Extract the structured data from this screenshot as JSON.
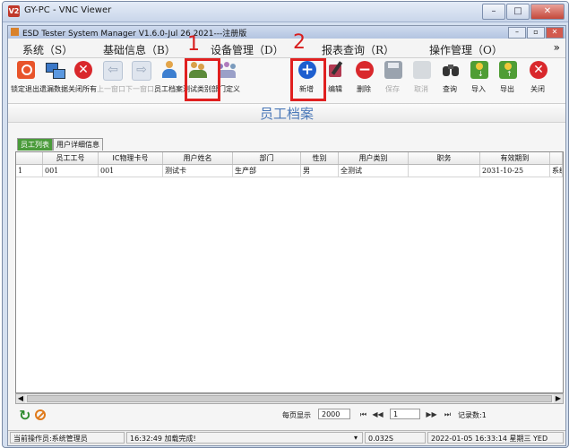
{
  "vnc": {
    "title": "GY-PC - VNC Viewer"
  },
  "app": {
    "title": "ESD Tester System Manager V1.6.0-Jul 26 2021---注册版"
  },
  "menu": [
    {
      "label": "系统（S）"
    },
    {
      "label": "基础信息（B）"
    },
    {
      "label": "设备管理（D）"
    },
    {
      "label": "报表查询（R）"
    },
    {
      "label": "操作管理（O）"
    }
  ],
  "menu_more": "»",
  "toolbar": [
    {
      "label": "锁定退出",
      "icon": "power-icon",
      "color": "#e8542a",
      "enabled": true
    },
    {
      "label": "遗漏数据",
      "icon": "network-icon",
      "color": "#3b78c8",
      "enabled": true
    },
    {
      "label": "关闭所有",
      "icon": "close-circle-icon",
      "color": "#d9282c",
      "enabled": true
    },
    {
      "label": "上一窗口",
      "icon": "arrow-left-icon",
      "color": "#b8c4d4",
      "enabled": false
    },
    {
      "label": "下一窗口",
      "icon": "arrow-right-icon",
      "color": "#b8c4d4",
      "enabled": false
    },
    {
      "label": "员工档案",
      "icon": "user-icon",
      "color": "#e3a54a",
      "enabled": true
    },
    {
      "label": "测试类别",
      "icon": "users-icon",
      "color": "#d9a049",
      "enabled": true
    },
    {
      "label": "部门定义",
      "icon": "group-icon",
      "color": "#8a7bbd",
      "enabled": true
    },
    {
      "label": "新增",
      "icon": "plus-circle-icon",
      "color": "#1e5fcf",
      "enabled": true
    },
    {
      "label": "编辑",
      "icon": "edit-icon",
      "color": "#b23a52",
      "enabled": true
    },
    {
      "label": "删除",
      "icon": "minus-circle-icon",
      "color": "#d9282c",
      "enabled": true
    },
    {
      "label": "保存",
      "icon": "save-icon",
      "color": "#9aa3ae",
      "enabled": false
    },
    {
      "label": "取消",
      "icon": "cancel-icon",
      "color": "#bfc5cc",
      "enabled": false
    },
    {
      "label": "查询",
      "icon": "binoculars-icon",
      "color": "#333333",
      "enabled": true
    },
    {
      "label": "导入",
      "icon": "import-icon",
      "color": "#4f9d35",
      "enabled": true
    },
    {
      "label": "导出",
      "icon": "export-icon",
      "color": "#4f9d35",
      "enabled": true
    },
    {
      "label": "关闭",
      "icon": "close-circle-icon",
      "color": "#d9282c",
      "enabled": true
    }
  ],
  "annotations": {
    "one": "1",
    "two": "2"
  },
  "page_title": "员工档案",
  "tabs": [
    {
      "label": "员工列表",
      "active": true
    },
    {
      "label": "用户详细信息",
      "active": false
    }
  ],
  "table": {
    "columns": [
      "",
      "员工工号",
      "IC物理卡号",
      "用户姓名",
      "部门",
      "性别",
      "用户类别",
      "职务",
      "有效期到",
      ""
    ],
    "rows": [
      [
        "1",
        "001",
        "001",
        "测试卡",
        "生产部",
        "男",
        "全测试",
        "",
        "2031-10-25",
        "系统"
      ]
    ]
  },
  "pager": {
    "per_page_label": "每页显示",
    "per_page": "2000",
    "page": "1",
    "records_label": "记录数:1"
  },
  "status": {
    "operator": "当前操作员:系统管理员",
    "message": "16:32:49 加载完成!",
    "timing": "0.032S",
    "datetime": "2022-01-05 16:33:14 星期三 YED"
  }
}
